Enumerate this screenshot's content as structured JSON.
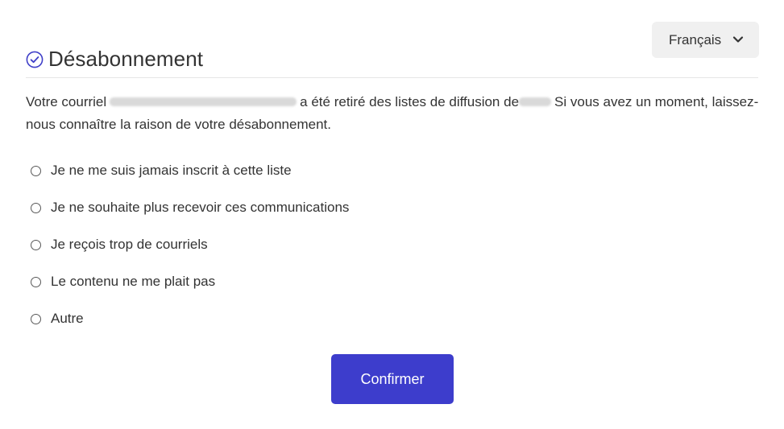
{
  "language_selector": {
    "selected": "Français"
  },
  "header": {
    "title": "Désabonnement"
  },
  "message": {
    "part1": "Votre courriel",
    "part2": "a été retiré des listes de diffusion de",
    "part3": "Si vous avez un moment, laissez-nous connaître la raison de votre désabonnement."
  },
  "reasons": [
    {
      "label": "Je ne me suis jamais inscrit à cette liste"
    },
    {
      "label": "Je ne souhaite plus recevoir ces communications"
    },
    {
      "label": "Je reçois trop de courriels"
    },
    {
      "label": "Le contenu ne me plait pas"
    },
    {
      "label": "Autre"
    }
  ],
  "actions": {
    "confirm_label": "Confirmer"
  },
  "colors": {
    "accent": "#3d3dcc",
    "check_icon": "#3f3fc8"
  }
}
